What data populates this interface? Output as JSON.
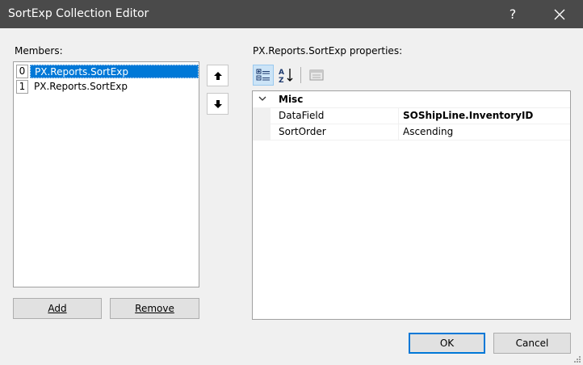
{
  "window": {
    "title": "SortExp Collection Editor",
    "help_label": "?"
  },
  "members": {
    "label": "Members:",
    "items": [
      {
        "index": "0",
        "text": "PX.Reports.SortExp",
        "selected": true
      },
      {
        "index": "1",
        "text": "PX.Reports.SortExp",
        "selected": false
      }
    ],
    "add_label": "Add",
    "remove_label": "Remove"
  },
  "properties": {
    "label": "PX.Reports.SortExp properties:",
    "category": "Misc",
    "rows": [
      {
        "name": "DataField",
        "value": "SOShipLine.InventoryID",
        "bold": true
      },
      {
        "name": "SortOrder",
        "value": "Ascending",
        "bold": false
      }
    ]
  },
  "footer": {
    "ok_label": "OK",
    "cancel_label": "Cancel"
  },
  "colors": {
    "titlebar": "#4a4a4a",
    "selection": "#0078d7",
    "dialog": "#f0f0f0"
  }
}
